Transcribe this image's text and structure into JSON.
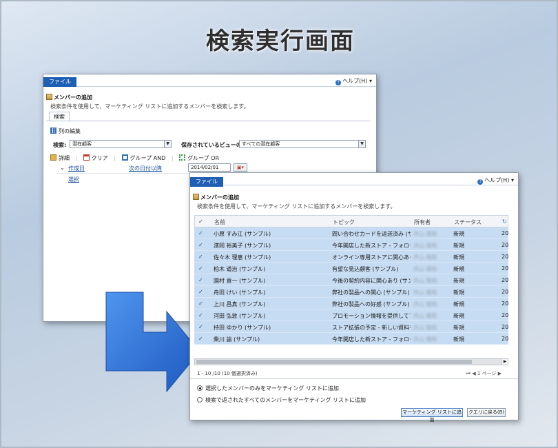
{
  "page_title": "検索実行画面",
  "back_window": {
    "file_tab": "ファイル",
    "help": "ヘルプ(H)",
    "title": "メンバーの追加",
    "subtitle": "検索条件を使用して、マーケティング リストに追加するメンバーを検索します。",
    "subtab": "検索",
    "edit_columns": "列の編集",
    "search_label": "検索:",
    "search_value": "潜在顧客",
    "saved_view_label": "保存されているビューの使用:",
    "saved_view_value": "すべての潜在顧客",
    "toolbar": {
      "detail": "詳細",
      "clear": "クリア",
      "group_and": "グループ AND",
      "group_or": "グループ OR"
    },
    "filter": {
      "field": "作成日",
      "operator": "次の日付以降",
      "value": "2014/02/01"
    },
    "select_link": "選択"
  },
  "front_window": {
    "file_tab": "ファイル",
    "help": "ヘルプ(H)",
    "title": "メンバーの追加",
    "subtitle": "検索条件を使用して、マーケティング リストに追加するメンバーを検索します。",
    "columns": {
      "check": "✓",
      "name": "名前",
      "topic": "トピック",
      "owner": "所有者",
      "status": "ステータス"
    },
    "rows": [
      {
        "name": "小原 すみ江 (サンプル)",
        "topic": "問い合わせカードを返送済み (サンプ…",
        "owner": "共山 陽和",
        "status": "新規",
        "date": "20"
      },
      {
        "name": "濱岡 裕美子 (サンプル)",
        "topic": "今年開店した新ストア - フォローアップ…",
        "owner": "共山 陽和",
        "status": "新規",
        "date": "20"
      },
      {
        "name": "佐々木 理恵 (サンプル)",
        "topic": "オンライン専用ストアに関心あり (サン…",
        "owner": "共山 陽和",
        "status": "新規",
        "date": "20"
      },
      {
        "name": "柏木 道治 (サンプル)",
        "topic": "有望な見込顧客 (サンプル)",
        "owner": "共山 陽和",
        "status": "新規",
        "date": "20"
      },
      {
        "name": "園村 貢一 (サンプル)",
        "topic": "今後の契約内容に関心あり (サンプル)",
        "owner": "共山 陽和",
        "status": "新規",
        "date": "20"
      },
      {
        "name": "舟田 けい (サンプル)",
        "topic": "弊社の製品への関心 (サンプル)",
        "owner": "共山 陽和",
        "status": "新規",
        "date": "20"
      },
      {
        "name": "上川 昌真 (サンプル)",
        "topic": "弊社の製品への好感 (サンプル)",
        "owner": "共山 陽和",
        "status": "新規",
        "date": "20"
      },
      {
        "name": "河田 弘敦 (サンプル)",
        "topic": "プロモーション情報を提供してフォロ…",
        "owner": "共山 陽和",
        "status": "新規",
        "date": "20"
      },
      {
        "name": "持田 ゆかり (サンプル)",
        "topic": "ストア拡張の予定 - 新しい資料を送…",
        "owner": "共山 陽和",
        "status": "新規",
        "date": "20"
      },
      {
        "name": "柴川 諭 (サンプル)",
        "topic": "今年開店した新ストア - フォローアップ…",
        "owner": "共山 陽和",
        "status": "新規",
        "date": "20"
      }
    ],
    "pager_info": "1 - 10 /10 (10 個選択済み)",
    "pager_nav": "1 ページ",
    "radio_selected": "選択したメンバーのみをマーケティング リストに追加",
    "radio_all": "検索で返されたすべてのメンバーをマーケティング リストに追加",
    "btn_add": "マーケティング リストに追加",
    "btn_back": "クエリに戻る(B)"
  },
  "colors": {
    "accent": "#1f5fb3",
    "selection": "#c6dcf2",
    "arrow": "#2f73d6"
  }
}
